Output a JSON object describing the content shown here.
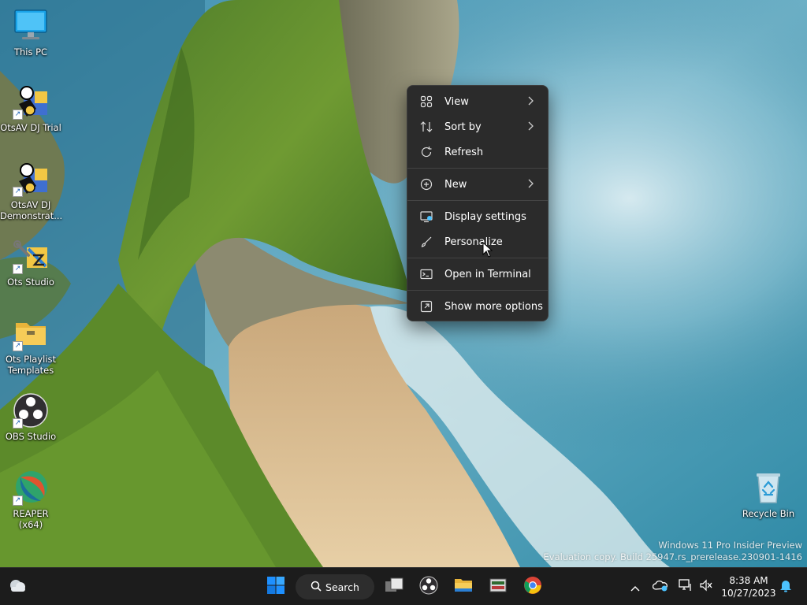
{
  "desktop_icons": [
    {
      "name": "this-pc",
      "label": "This PC"
    },
    {
      "name": "otsav-dj-trial",
      "label": "OtsAV DJ Trial"
    },
    {
      "name": "otsav-dj-demonstrat",
      "label": "OtsAV DJ\nDemonstrat..."
    },
    {
      "name": "ots-studio",
      "label": "Ots Studio"
    },
    {
      "name": "ots-playlist-templates",
      "label": "Ots Playlist\nTemplates"
    },
    {
      "name": "obs-studio",
      "label": "OBS Studio"
    },
    {
      "name": "reaper",
      "label": "REAPER (x64)"
    },
    {
      "name": "recycle-bin",
      "label": "Recycle Bin"
    }
  ],
  "context_menu": {
    "items": [
      {
        "label": "View",
        "icon": "grid-icon",
        "submenu": true
      },
      {
        "label": "Sort by",
        "icon": "sort-icon",
        "submenu": true
      },
      {
        "label": "Refresh",
        "icon": "refresh-icon",
        "submenu": false
      },
      {
        "label": "New",
        "icon": "plus-circle-icon",
        "submenu": true
      },
      {
        "label": "Display settings",
        "icon": "display-icon",
        "submenu": false
      },
      {
        "label": "Personalize",
        "icon": "brush-icon",
        "submenu": false
      },
      {
        "label": "Open in Terminal",
        "icon": "terminal-icon",
        "submenu": false
      },
      {
        "label": "Show more options",
        "icon": "more-options-icon",
        "submenu": false
      }
    ]
  },
  "watermark": {
    "line1": "Windows 11 Pro Insider Preview",
    "line2": "Evaluation copy. Build 25947.rs_prerelease.230901-1416"
  },
  "taskbar": {
    "search_label": "Search",
    "time": "8:38 AM",
    "date": "10/27/2023"
  },
  "colors": {
    "menu_bg": "#2b2b2b",
    "taskbar_bg": "#1c1c1c",
    "accent": "#4cc2ff",
    "windows_blue": "#1e90ff"
  }
}
